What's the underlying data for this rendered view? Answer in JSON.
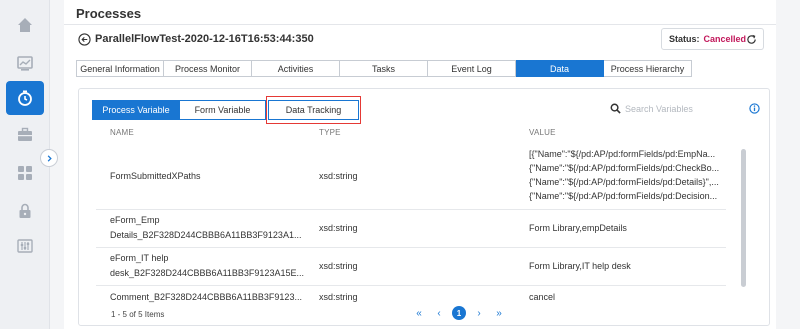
{
  "sidebar": {
    "items": [
      {
        "icon": "home-icon"
      },
      {
        "icon": "chart-icon"
      },
      {
        "icon": "timer-icon",
        "active": true
      },
      {
        "icon": "briefcase-icon"
      },
      {
        "icon": "grid-icon"
      },
      {
        "icon": "lock-icon"
      },
      {
        "icon": "sliders-icon"
      }
    ],
    "accent": "#1976d2"
  },
  "header": {
    "page_title": "Processes",
    "process_title": "ParallelFlowTest-2020-12-16T16:53:44:350",
    "status_label": "Status:",
    "status_value": "Cancelled",
    "status_color": "#c2185b"
  },
  "tabs": [
    {
      "label": "General Information",
      "active": false
    },
    {
      "label": "Process Monitor",
      "active": false
    },
    {
      "label": "Activities",
      "active": false
    },
    {
      "label": "Tasks",
      "active": false
    },
    {
      "label": "Event Log",
      "active": false
    },
    {
      "label": "Data",
      "active": true
    },
    {
      "label": "Process Hierarchy",
      "active": false
    }
  ],
  "subtabs": [
    {
      "label": "Process Variable",
      "active": true
    },
    {
      "label": "Form Variable",
      "active": false
    },
    {
      "label": "Data Tracking",
      "active": false
    }
  ],
  "search": {
    "placeholder": "Search Variables"
  },
  "table": {
    "columns": [
      "NAME",
      "TYPE",
      "VALUE"
    ],
    "rows": [
      {
        "name": [
          "FormSubmittedXPaths"
        ],
        "type": "xsd:string",
        "value": [
          "[{\"Name\":\"${/pd:AP/pd:formFields/pd:EmpNa...",
          "{\"Name\":\"${/pd:AP/pd:formFields/pd:CheckBo...",
          "{\"Name\":\"${/pd:AP/pd:formFields/pd:Details}\",...",
          "{\"Name\":\"${/pd:AP/pd:formFields/pd:Decision..."
        ]
      },
      {
        "name": [
          "eForm_Emp",
          "Details_B2F328D244CBBB6A11BB3F9123A1..."
        ],
        "type": "xsd:string",
        "value": [
          "Form Library,empDetails"
        ]
      },
      {
        "name": [
          "eForm_IT help",
          "desk_B2F328D244CBBB6A11BB3F9123A15E..."
        ],
        "type": "xsd:string",
        "value": [
          "Form Library,IT help desk"
        ]
      },
      {
        "name": [
          "Comment_B2F328D244CBBB6A11BB3F9123..."
        ],
        "type": "xsd:string",
        "value": [
          "cancel"
        ]
      }
    ]
  },
  "footer": {
    "count_text": "1 - 5 of 5 Items",
    "current_page": "1",
    "first": "«",
    "prev": "‹",
    "next": "›",
    "last": "»"
  }
}
